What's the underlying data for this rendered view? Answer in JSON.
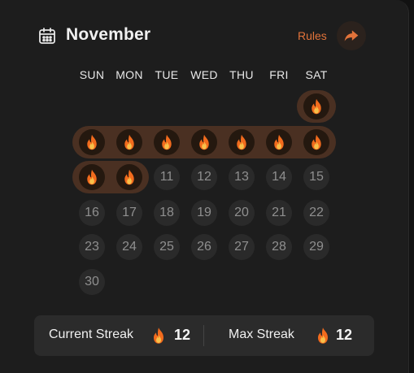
{
  "header": {
    "month": "November",
    "rules_label": "Rules",
    "calendar_icon": "calendar-icon",
    "share_icon": "share-arrow-icon"
  },
  "weekdays": [
    "SUN",
    "MON",
    "TUE",
    "WED",
    "THU",
    "FRI",
    "SAT"
  ],
  "calendar": {
    "leading_blank_days": 6,
    "days_in_month": 30,
    "streak_days": [
      1,
      2,
      3,
      4,
      5,
      6,
      7,
      8,
      9,
      10
    ],
    "streak_icon": "flame-icon"
  },
  "footer": {
    "current_streak_label": "Current Streak",
    "current_streak_value": "12",
    "max_streak_label": "Max Streak",
    "max_streak_value": "12"
  },
  "colors": {
    "accent": "#e2733a",
    "flame_outer": "#f26b1d",
    "flame_inner": "#f7c04a",
    "streak_highlight": "#4a3022"
  }
}
